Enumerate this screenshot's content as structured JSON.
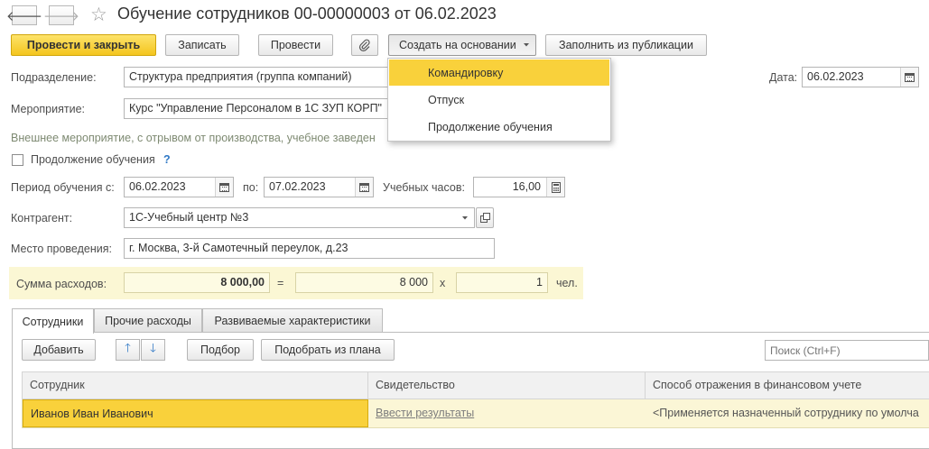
{
  "window": {
    "title": "Обучение сотрудников 00-00000003 от 06.02.2023",
    "back_glyph": "🡐",
    "forward_glyph": "🡒",
    "star_glyph": "☆"
  },
  "toolbar": {
    "post_close": "Провести и закрыть",
    "save": "Записать",
    "post": "Провести",
    "create_based_on": "Создать на основании",
    "fill_from_publication": "Заполнить из публикации"
  },
  "create_menu": {
    "items": [
      "Командировку",
      "Отпуск",
      "Продолжение обучения"
    ],
    "active_index": 0
  },
  "form": {
    "department_label": "Подразделение:",
    "department_value": "Структура предприятия (группа компаний)",
    "date_label": "Дата:",
    "date_value": "06.02.2023",
    "event_label": "Мероприятие:",
    "event_value": "Курс \"Управление Персоналом в 1С ЗУП КОРП\"",
    "event_description_left": "Внешнее мероприятие, с отрывом от производства, учебное заведен",
    "event_description_right": "",
    "continuation_label": "Продолжение обучения",
    "help_glyph": "?",
    "period_label": "Период обучения с:",
    "period_from": "06.02.2023",
    "period_to_label": "по:",
    "period_to": "07.02.2023",
    "hours_label": "Учебных часов:",
    "hours_value": "16,00",
    "contractor_label": "Контрагент:",
    "contractor_value": "1С-Учебный центр №3",
    "location_label": "Место проведения:",
    "location_value": "г. Москва, 3-й Самотечный переулок, д.23",
    "expenses_label": "Сумма расходов:",
    "expenses_total": "8 000,00",
    "equals_sign": "=",
    "expenses_per_person": "8 000",
    "times_sign": "x",
    "persons_count": "1",
    "persons_unit": "чел."
  },
  "tabs": [
    {
      "label": "Сотрудники"
    },
    {
      "label": "Прочие расходы"
    },
    {
      "label": "Развиваемые характеристики"
    }
  ],
  "employees_panel": {
    "add_button": "Добавить",
    "up_glyph": "🡑",
    "down_glyph": "🡓",
    "select_button": "Подбор",
    "select_from_plan_button": "Подобрать из плана",
    "search_placeholder": "Поиск (Ctrl+F)",
    "columns": [
      "Сотрудник",
      "Свидетельство",
      "Способ отражения в финансовом учете"
    ],
    "rows": [
      {
        "employee": "Иванов Иван Иванович",
        "certificate": "Ввести результаты",
        "accounting": "<Применяется назначенный сотруднику по умолча"
      }
    ]
  },
  "colors": {
    "accent_yellow": "#f9d13b",
    "primary_button": "#f4c51e",
    "highlight_strip": "#fbf7d4",
    "arrow_blue": "#2f78c5"
  }
}
